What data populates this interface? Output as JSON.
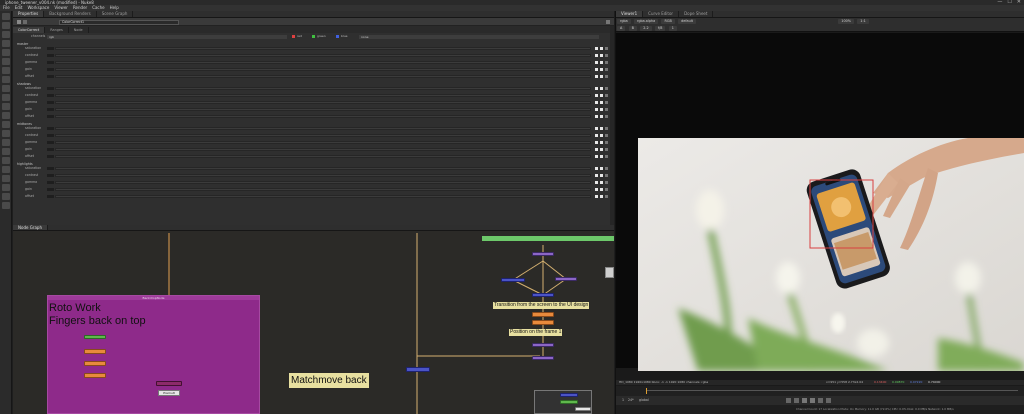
{
  "window": {
    "title": "iphone_tweener_v004.nk (modified) - Nuke8",
    "controls": [
      "—",
      "☐",
      "✕"
    ]
  },
  "menu": [
    "File",
    "Edit",
    "Workspace",
    "Viewer",
    "Render",
    "Cache",
    "Help"
  ],
  "left_tabs": [
    "Properties",
    "Background Renders",
    "Scene Graph"
  ],
  "properties": {
    "node_name": "ColorCorrect1",
    "node_tabs": [
      "ColorCorrect",
      "Ranges",
      "Node"
    ],
    "channels_label": "channels",
    "channels_value": "rgb",
    "channel_checks": [
      "red",
      "green",
      "blue"
    ],
    "channel_extra": "none",
    "groups": [
      {
        "name": "master",
        "rows": [
          "saturation",
          "contrast",
          "gamma",
          "gain",
          "offset"
        ]
      },
      {
        "name": "shadows",
        "rows": [
          "saturation",
          "contrast",
          "gamma",
          "gain",
          "offset"
        ]
      },
      {
        "name": "midtones",
        "rows": [
          "saturation",
          "contrast",
          "gamma",
          "gain",
          "offset"
        ]
      },
      {
        "name": "highlights",
        "rows": [
          "saturation",
          "contrast",
          "gamma",
          "gain",
          "offset"
        ]
      }
    ]
  },
  "nodegraph": {
    "tab": "Node Graph",
    "backdrop_title": "BackdropNode",
    "backdrop_note": "Roto Work\nFingers back on top",
    "note_matchmove": "Matchmove back",
    "note_transition": "Transition from the screen to the UI design",
    "note_position": "Position on the frame 1",
    "node_premult": "Premult",
    "node_stencil": "Stencil"
  },
  "viewer": {
    "tabs": [
      "Viewer1",
      "Curve Editor",
      "Dope Sheet"
    ],
    "controls_row1": [
      "rgba",
      "rgba.alpha",
      "RGB",
      "default"
    ],
    "controls_row2": [
      "A",
      "B",
      "2.2",
      "f/8",
      "1"
    ],
    "zoom": "100%",
    "frame_display": "1:1",
    "info_left": "HD_1080 1920x1080  bbox: -1 -1 1920 1080 channels: rgba",
    "info_right": "x=951 y=558 2.73x2.04",
    "info_values": [
      "0.13400",
      "0.09870",
      "0.07220",
      "0.74000"
    ],
    "frame_current": "1",
    "fps": "24*",
    "range_label": "global",
    "status": "Channel Count: 17 Localization Mode: On Memory: 11.0 GB (72.6%) CPU: 0.0% Disk: 0.0 MB/s Network: 1.0 MB/s"
  },
  "colors": {
    "backdrop": "#8e2a8a",
    "note_yellow": "#e8e0a0",
    "node_orange": "#e88a3c",
    "node_purple": "#8c66c6",
    "node_blue": "#4b54c6",
    "node_green": "#5fb84c",
    "bar_green": "#6dc86a"
  }
}
